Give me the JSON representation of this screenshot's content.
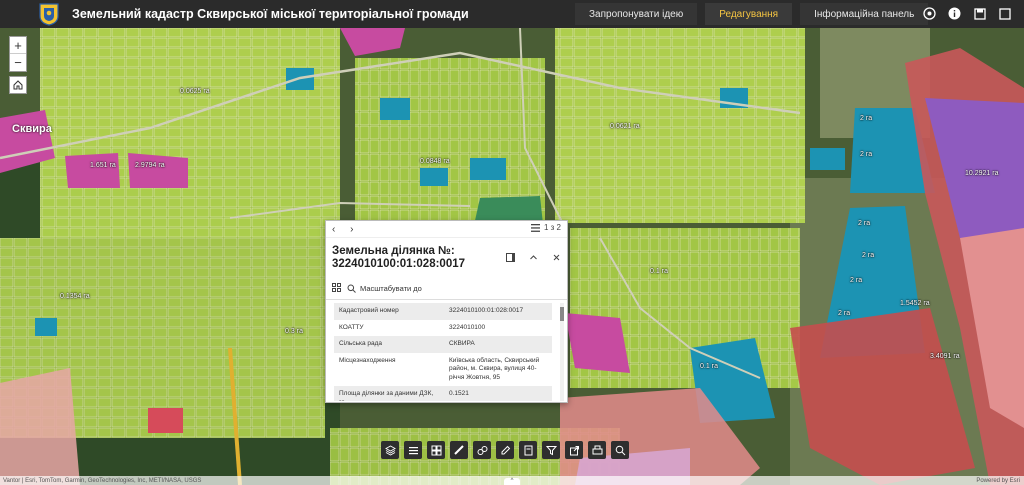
{
  "header": {
    "title": "Земельний кадастр Сквирської міської територіальної громади",
    "nav": [
      {
        "label": "Запропонувати ідею"
      },
      {
        "label": "Редагування"
      },
      {
        "label": "Інформаційна панель"
      }
    ],
    "active_color": "#f5c542"
  },
  "map": {
    "place_label": "Сквира",
    "parcel_labels": [
      "0.1 га",
      "2 га",
      "0.0621 га",
      "10.2921 га",
      "1.5452 га",
      "3.4091 га",
      "0.0625 га",
      "0.3 га",
      "2.9794 га",
      "1.651 га",
      "0.0848 га",
      "0.1354 га"
    ],
    "colors": {
      "residential": "#b8d94a",
      "commercial": "#1c93b3",
      "industrial": "#c95a5a",
      "special": "#c74ba0",
      "water": "#e8a6a6",
      "dark_green": "#2f6e3c"
    }
  },
  "popup": {
    "counter": "1 з 2",
    "title": "Земельна ділянка №: 3224010100:01:028:0017",
    "zoom_to": "Масштабувати до",
    "attributes": [
      {
        "key": "Кадастровий номер",
        "value": "3224010100:01:028:0017"
      },
      {
        "key": "КОАТТУ",
        "value": "3224010100"
      },
      {
        "key": "Сільська рада",
        "value": "СКВИРА"
      },
      {
        "key": "Місцезнаходження",
        "value": "Київська область, Сквирський район, м. Сквира, вулиця 40-річчя Жовтня, 95"
      },
      {
        "key": "Площа ділянки за даними ДЗК, га",
        "value": "0.1521"
      }
    ]
  },
  "attribution": {
    "text": "Vantor | Esri, TomTom, Garmin, GeoTechnologies, Inc, METI/NASA, USGS",
    "powered": "Powered by Esri"
  }
}
